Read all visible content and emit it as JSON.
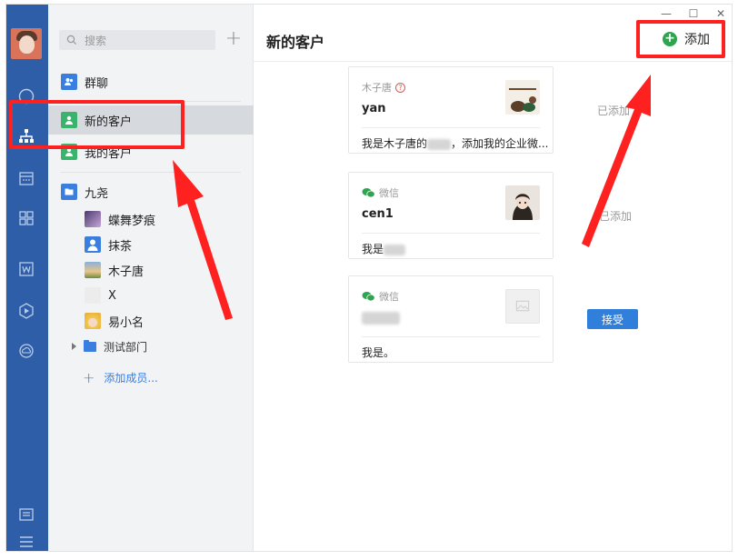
{
  "rail": {
    "icons": [
      "avatar",
      "chat-bubble-icon",
      "contacts-org-icon",
      "calendar-icon",
      "apps-grid-icon",
      "doc-w-icon",
      "cube-icon",
      "cloud-icon",
      "notes-icon",
      "menu-icon"
    ],
    "accent": "#2f5ea8"
  },
  "panel": {
    "search_placeholder": "搜索",
    "plus": "+",
    "group_chat": "群聊",
    "new_customers": "新的客户",
    "my_customers": "我的客户",
    "department": "九尧",
    "members": [
      {
        "name": "蝶舞梦痕"
      },
      {
        "name": "抹茶"
      },
      {
        "name": "木子唐"
      },
      {
        "name": "X"
      },
      {
        "name": "易小名"
      }
    ],
    "sub_department": "测试部门",
    "add_member": "添加成员..."
  },
  "main": {
    "title": "新的客户",
    "add_label": "添加",
    "window_controls": [
      "—",
      "☐",
      "✕"
    ],
    "cards": [
      {
        "source": "木子唐",
        "name": "yan",
        "message": "我是木子唐的",
        "message_tail": "，添加我的企业微...",
        "status": "已添加"
      },
      {
        "source": "微信",
        "name": "cen1",
        "message": "我是",
        "status": "已添加"
      },
      {
        "source": "微信",
        "name": "",
        "message": "我是。",
        "action": "接受"
      }
    ]
  },
  "colors": {
    "highlight_red": "#ff2020",
    "accept_blue": "#2f7fdb",
    "wechat_green": "#2da44e"
  }
}
